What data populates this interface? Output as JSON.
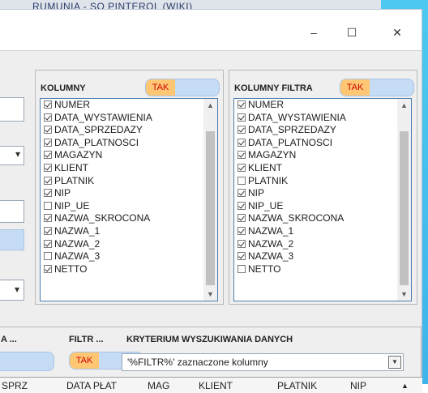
{
  "background": {
    "window_title_partial": "RUMUNIA - SQ PINTEROL (WIKI)"
  },
  "window_controls": {
    "minimize": "–",
    "maximize": "☐",
    "close": "✕"
  },
  "left_stub": {
    "combo_arrow": "▾",
    "combo_arrow2": "▾"
  },
  "kolumny": {
    "title": "KOLUMNY",
    "toggle_label": "TAK",
    "items": [
      {
        "label": "NUMER",
        "checked": true
      },
      {
        "label": "DATA_WYSTAWIENIA",
        "checked": true
      },
      {
        "label": "DATA_SPRZEDAZY",
        "checked": true
      },
      {
        "label": "DATA_PLATNOSCI",
        "checked": true
      },
      {
        "label": "MAGAZYN",
        "checked": true
      },
      {
        "label": "KLIENT",
        "checked": true
      },
      {
        "label": "PLATNIK",
        "checked": true
      },
      {
        "label": "NIP",
        "checked": true
      },
      {
        "label": "NIP_UE",
        "checked": false
      },
      {
        "label": "NAZWA_SKROCONA",
        "checked": true
      },
      {
        "label": "NAZWA_1",
        "checked": true
      },
      {
        "label": "NAZWA_2",
        "checked": true
      },
      {
        "label": "NAZWA_3",
        "checked": false
      },
      {
        "label": "NETTO",
        "checked": true
      }
    ]
  },
  "kolumny_filtra": {
    "title": "KOLUMNY FILTRA",
    "toggle_label": "TAK",
    "items": [
      {
        "label": "NUMER",
        "checked": true
      },
      {
        "label": "DATA_WYSTAWIENIA",
        "checked": true
      },
      {
        "label": "DATA_SPRZEDAZY",
        "checked": true
      },
      {
        "label": "DATA_PLATNOSCI",
        "checked": true
      },
      {
        "label": "MAGAZYN",
        "checked": true
      },
      {
        "label": "KLIENT",
        "checked": true
      },
      {
        "label": "PLATNIK",
        "checked": false
      },
      {
        "label": "NIP",
        "checked": true
      },
      {
        "label": "NIP_UE",
        "checked": true
      },
      {
        "label": "NAZWA_SKROCONA",
        "checked": true
      },
      {
        "label": "NAZWA_1",
        "checked": true
      },
      {
        "label": "NAZWA_2",
        "checked": true
      },
      {
        "label": "NAZWA_3",
        "checked": true
      },
      {
        "label": "NETTO",
        "checked": false
      }
    ]
  },
  "scroll": {
    "up": "▲",
    "down": "▼"
  },
  "filter_section": {
    "col1_header": "A ...",
    "col2_header": "FILTR ...",
    "col3_header": "KRYTERIUM WYSZUKIWANIA DANYCH",
    "toggle_label": "TAK",
    "criterion_value": "'%FILTR%' zaznaczone kolumny",
    "combo_arrow": "▼"
  },
  "grid_headers": [
    "SPRZ",
    "DATA PŁAT",
    "MAG",
    "KLIENT",
    "PŁATNIK",
    "NIP"
  ],
  "grid_scroll_up": "▲"
}
